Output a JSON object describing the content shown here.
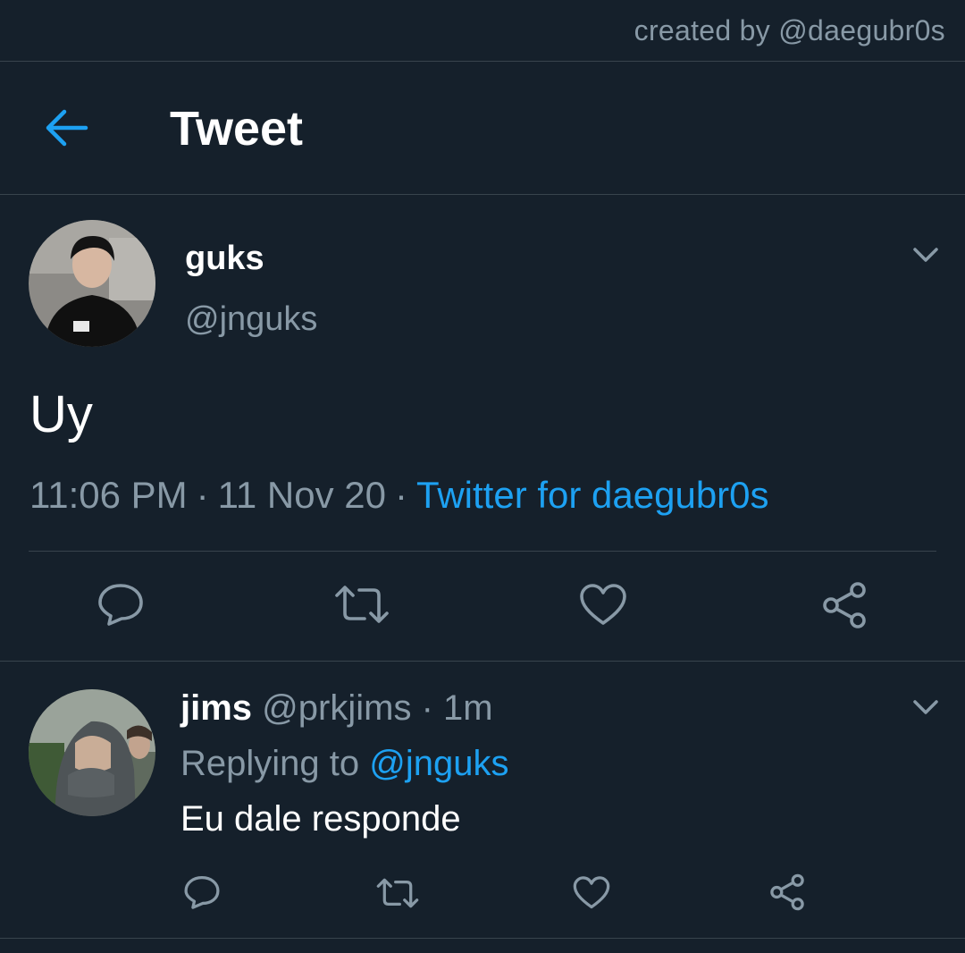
{
  "credit": "created by @daegubr0s",
  "header": {
    "back_icon": "arrow-left-icon",
    "title": "Tweet"
  },
  "tweet": {
    "avatar": "profile-photo",
    "name": "guks",
    "handle": "@jnguks",
    "text": "Uy",
    "time": "11:06 PM",
    "date": "11 Nov 20",
    "separator": "·",
    "source": "Twitter for daegubr0s",
    "actions": [
      "reply-icon",
      "retweet-icon",
      "like-icon",
      "share-icon"
    ]
  },
  "reply": {
    "avatar": "profile-photo",
    "name": "jims",
    "handle": "@prkjims",
    "separator": "·",
    "time": "1m",
    "replying_prefix": "Replying to",
    "replying_to": "@jnguks",
    "text": "Eu dale responde",
    "actions": [
      "reply-icon",
      "retweet-icon",
      "like-icon",
      "share-icon"
    ]
  },
  "colors": {
    "background": "#15202b",
    "accent": "#1da1f2",
    "muted": "#8899a6",
    "border": "#38444d",
    "text": "#ffffff"
  }
}
